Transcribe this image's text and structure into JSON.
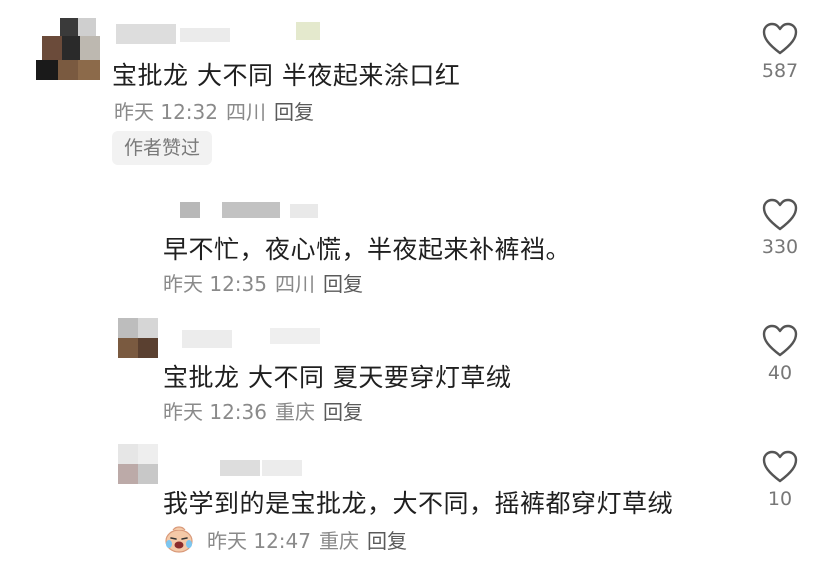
{
  "comments": [
    {
      "text": "宝批龙 大不同 半夜起来涂口红",
      "time": "昨天 12:32",
      "location": "四川",
      "reply_label": "回复",
      "badge": "作者赞过",
      "likes": "587"
    },
    {
      "text": "早不忙，夜心慌，半夜起来补裤裆。",
      "time": "昨天 12:35",
      "location": "四川",
      "reply_label": "回复",
      "likes": "330"
    },
    {
      "text": "宝批龙 大不同 夏天要穿灯草绒",
      "time": "昨天 12:36",
      "location": "重庆",
      "reply_label": "回复",
      "likes": "40"
    },
    {
      "text": "我学到的是宝批龙，大不同，摇裤都穿灯草绒",
      "time": "昨天 12:47",
      "location": "重庆",
      "reply_label": "回复",
      "likes": "10"
    }
  ],
  "icons": {
    "like": "heart-outline-icon",
    "emoji": "crying-laughing-emoji-icon"
  },
  "colors": {
    "text": "#1f1f1f",
    "meta": "#8a8a8a",
    "badge_bg": "#f2f2f2"
  }
}
